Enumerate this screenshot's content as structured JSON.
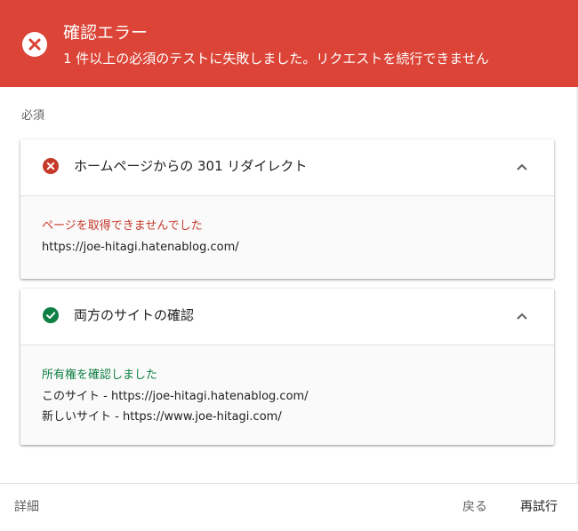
{
  "header": {
    "title": "確認エラー",
    "subtitle": "1 件以上の必須のテストに失敗しました。リクエストを続行できません",
    "icon": "error-circle-icon",
    "background": "#db4437"
  },
  "section_label": "必須",
  "checks": [
    {
      "title": "ホームページからの 301 リダイレクト",
      "status": "error",
      "status_color": "#c5392a",
      "message": "ページを取得できませんでした",
      "lines": [
        "https://joe-hitagi.hatenablog.com/"
      ]
    },
    {
      "title": "両方のサイトの確認",
      "status": "success",
      "status_color": "#0f8043",
      "message": "所有権を確認しました",
      "lines": [
        "このサイト - https://joe-hitagi.hatenablog.com/",
        "新しいサイト - https://www.joe-hitagi.com/"
      ]
    }
  ],
  "footer": {
    "details_label": "詳細",
    "back_label": "戻る",
    "retry_label": "再試行"
  }
}
